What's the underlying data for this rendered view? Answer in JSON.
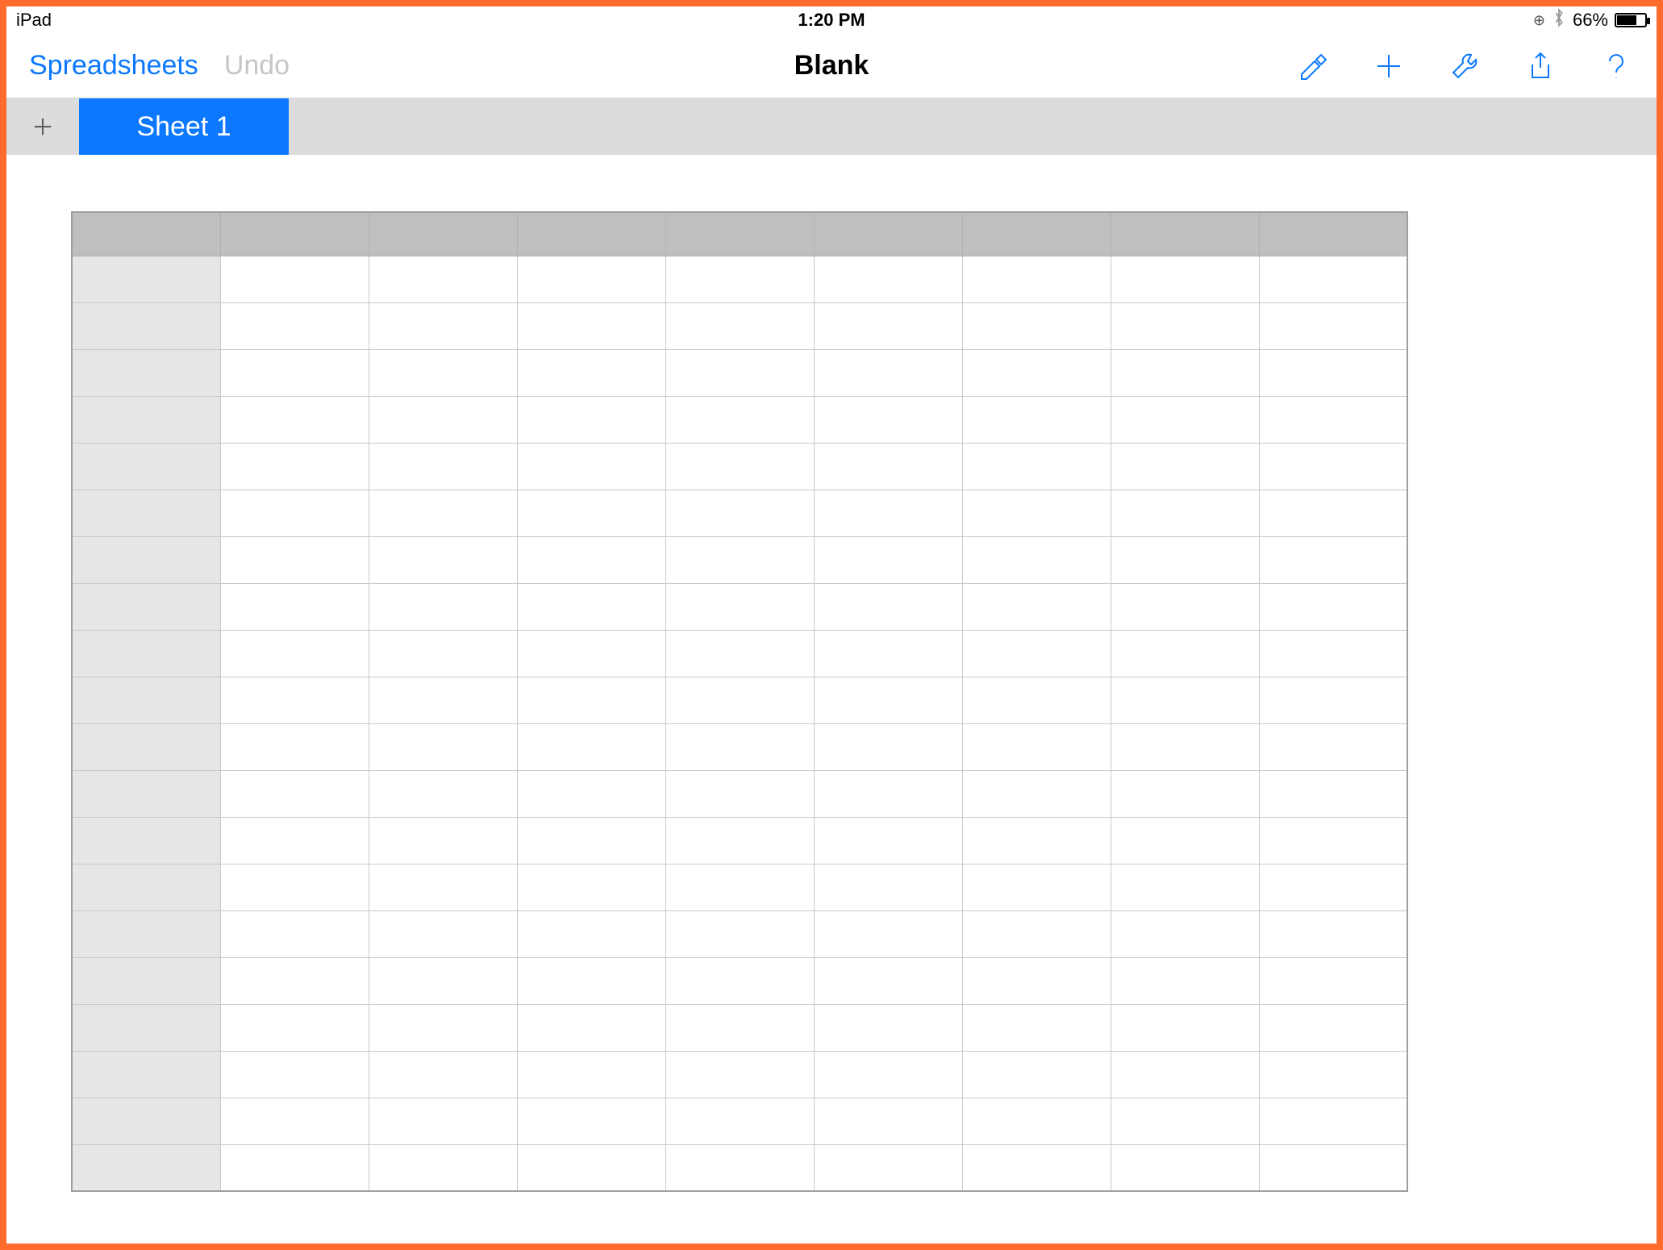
{
  "status": {
    "device": "iPad",
    "time": "1:20 PM",
    "battery_pct": "66%"
  },
  "toolbar": {
    "back_label": "Spreadsheets",
    "undo_label": "Undo",
    "title": "Blank"
  },
  "tabs": {
    "active_label": "Sheet 1"
  },
  "grid": {
    "columns": 8,
    "rows": 20,
    "column_headers": [
      "",
      "",
      "",
      "",
      "",
      "",
      "",
      ""
    ],
    "row_headers": [
      "",
      "",
      "",
      "",
      "",
      "",
      "",
      "",
      "",
      "",
      "",
      "",
      "",
      "",
      "",
      "",
      "",
      "",
      "",
      ""
    ],
    "cells": []
  },
  "colors": {
    "accent": "#0b78ff",
    "frame": "#ff6b2d",
    "tab_bg": "#dcdcdc",
    "header_bg": "#bfbfbf",
    "rowhead_bg": "#e6e6e6"
  }
}
